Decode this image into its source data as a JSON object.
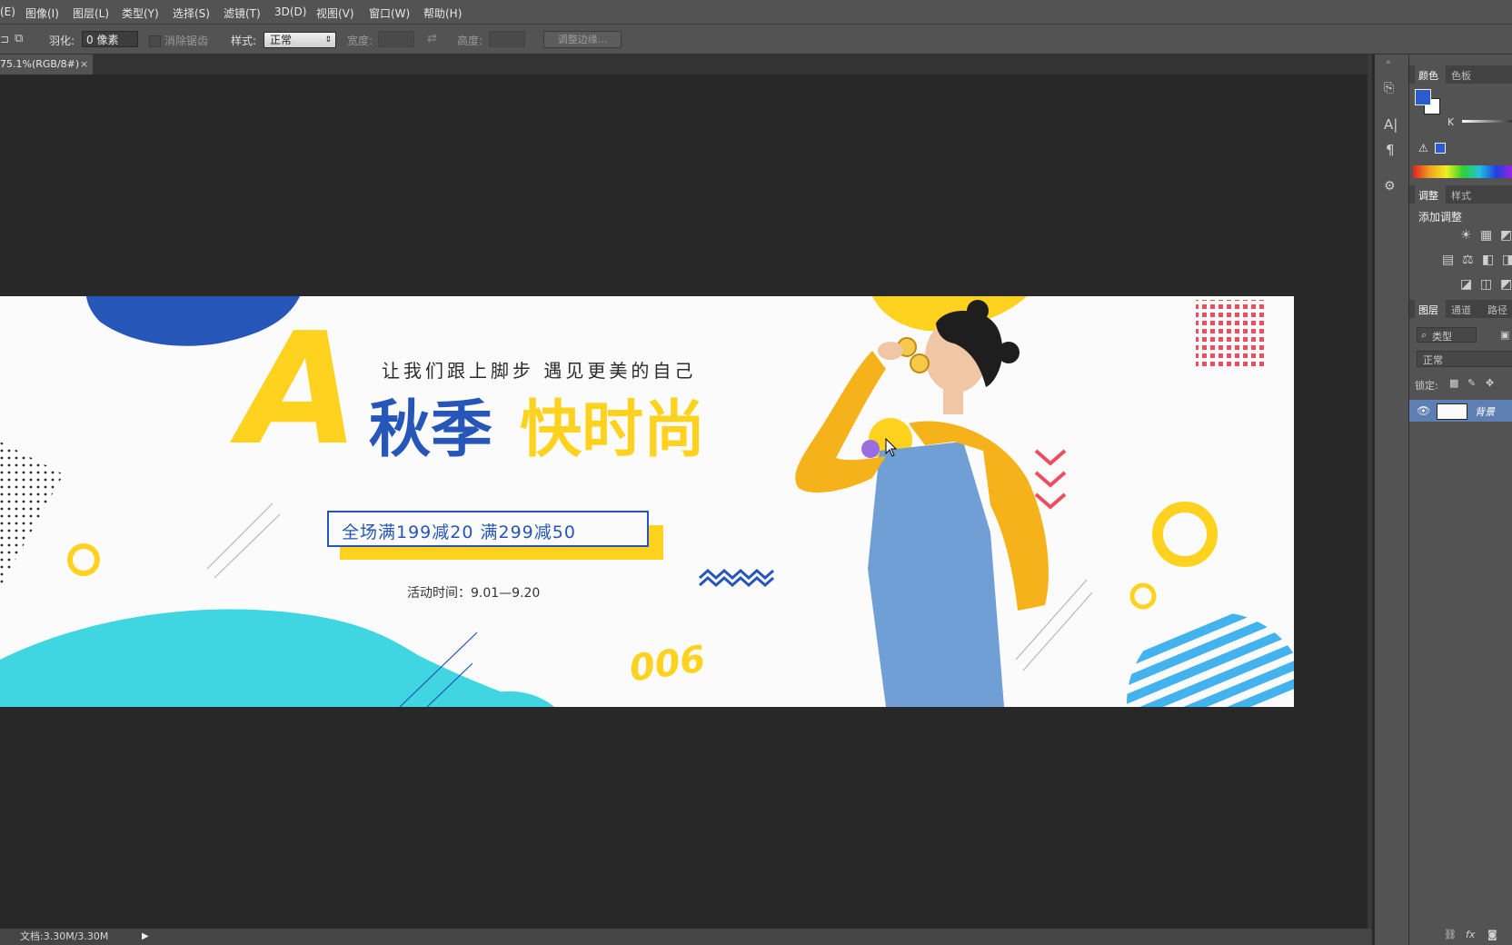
{
  "menu": [
    "(E)",
    "图像(I)",
    "图层(L)",
    "类型(Y)",
    "选择(S)",
    "滤镜(T)",
    "3D(D)",
    "视图(V)",
    "窗口(W)",
    "帮助(H)"
  ],
  "options": {
    "feather_label": "羽化:",
    "feather_value": "0 像素",
    "antialias_label": "消除锯齿",
    "style_label": "样式:",
    "style_value": "正常",
    "width_label": "宽度:",
    "height_label": "高度:",
    "refine_edge_label": "调整边缘..."
  },
  "document": {
    "tab_label": "75.1%(RGB/8#)",
    "close_glyph": "×",
    "status": "文档:3.30M/3.30M"
  },
  "banner": {
    "big_letter": "A",
    "slogan": "让我们跟上脚步 遇见更美的自己",
    "title_blue": "秋季",
    "title_yellow": "快时尚",
    "promo": "全场满199减20 满299减50",
    "activity_time": "活动时间：9.01—9.20",
    "deco_number": "006",
    "colors": {
      "blue": "#2556b8",
      "yellow": "#ffd21f",
      "cyan": "#3fd6e2",
      "red": "#ee4d5e",
      "light_blue": "#42b3ee"
    }
  },
  "panels": {
    "color_tabs": [
      "颜色",
      "色板"
    ],
    "k_label": "K",
    "adjust_tabs": [
      "调整",
      "样式"
    ],
    "add_adjustment": "添加调整",
    "layer_tabs": [
      "图层",
      "通道",
      "路径"
    ],
    "kind_filter": "类型",
    "blend_mode": "正常",
    "lock_label": "锁定:",
    "layer_name": "背景",
    "foreground_color": "#2a5bd0",
    "background_color": "#ffffff"
  }
}
